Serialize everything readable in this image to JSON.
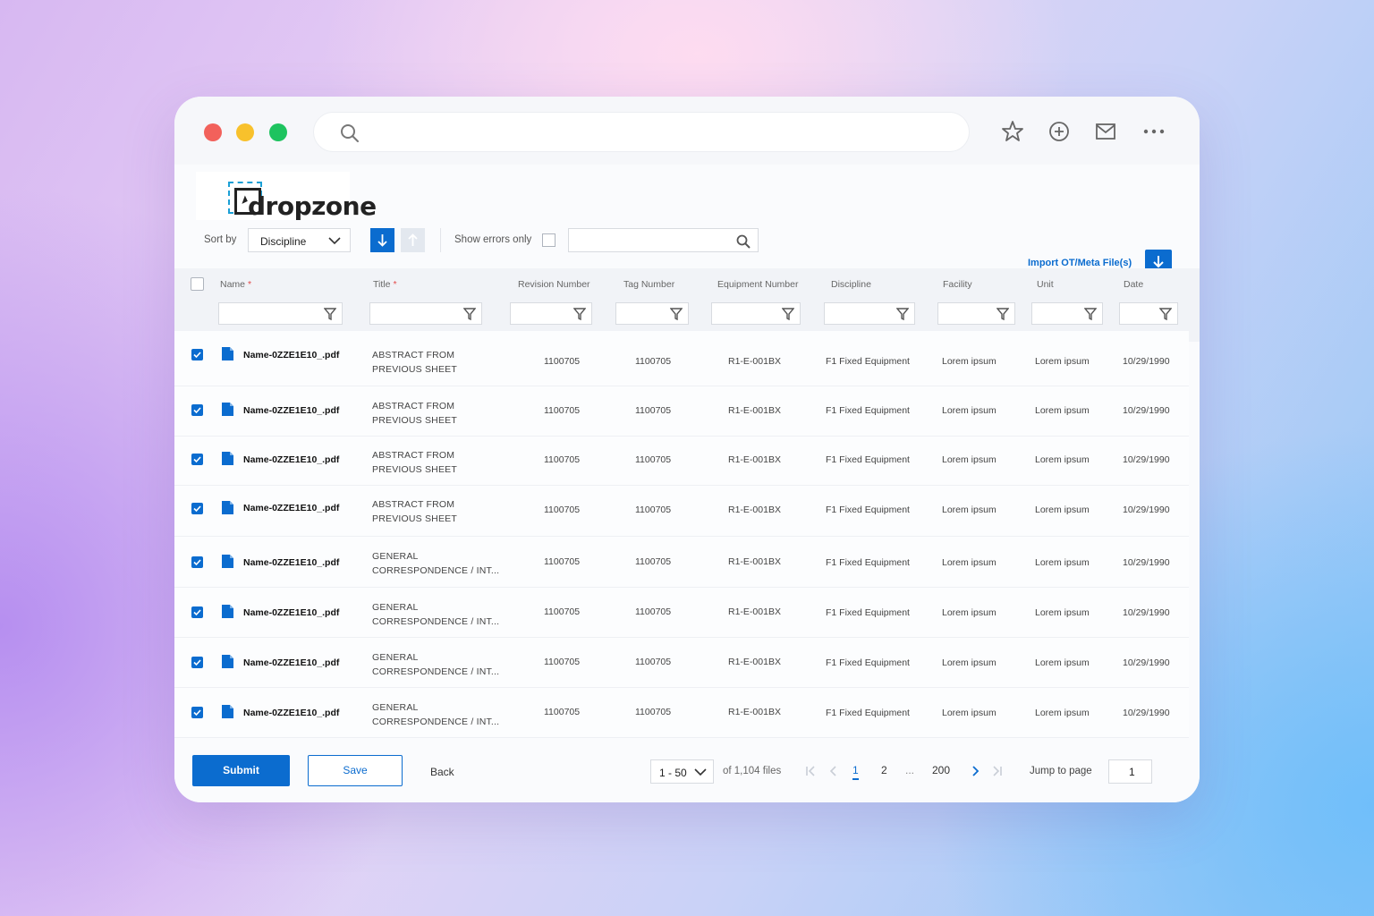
{
  "app": {
    "logo_text": "dropzone"
  },
  "header": {
    "import_label": "Import OT/Meta File(s)"
  },
  "toolbar": {
    "sort_label": "Sort by",
    "sort_value": "Discipline",
    "show_errors_label": "Show errors only",
    "search_placeholder": ""
  },
  "columns": [
    {
      "label": "Name",
      "required": "*"
    },
    {
      "label": "Title",
      "required": "*"
    },
    {
      "label": "Revision Number"
    },
    {
      "label": "Tag Number"
    },
    {
      "label": "Equipment Number"
    },
    {
      "label": "Discipline"
    },
    {
      "label": "Facility"
    },
    {
      "label": "Unit"
    },
    {
      "label": "Date"
    }
  ],
  "rows": [
    {
      "name": "Name-0ZZE1E10_.pdf",
      "title1": "ABSTRACT FROM",
      "title2": "PREVIOUS SHEET",
      "revision": "1100705",
      "tag": "1100705",
      "equipment": "R1-E-001BX",
      "discipline": "F1 Fixed Equipment",
      "facility": "Lorem ipsum",
      "unit": "Lorem ipsum",
      "date": "10/29/1990"
    },
    {
      "name": "Name-0ZZE1E10_.pdf",
      "title1": "ABSTRACT FROM",
      "title2": "PREVIOUS SHEET",
      "revision": "1100705",
      "tag": "1100705",
      "equipment": "R1-E-001BX",
      "discipline": "F1 Fixed Equipment",
      "facility": "Lorem ipsum",
      "unit": "Lorem ipsum",
      "date": "10/29/1990"
    },
    {
      "name": "Name-0ZZE1E10_.pdf",
      "title1": "ABSTRACT FROM",
      "title2": "PREVIOUS SHEET",
      "revision": "1100705",
      "tag": "1100705",
      "equipment": "R1-E-001BX",
      "discipline": "F1 Fixed Equipment",
      "facility": "Lorem ipsum",
      "unit": "Lorem ipsum",
      "date": "10/29/1990"
    },
    {
      "name": "Name-0ZZE1E10_.pdf",
      "title1": "ABSTRACT FROM",
      "title2": "PREVIOUS SHEET",
      "revision": "1100705",
      "tag": "1100705",
      "equipment": "R1-E-001BX",
      "discipline": "F1 Fixed Equipment",
      "facility": "Lorem ipsum",
      "unit": "Lorem ipsum",
      "date": "10/29/1990"
    },
    {
      "name": "Name-0ZZE1E10_.pdf",
      "title1": "GENERAL",
      "title2": "CORRESPONDENCE / INT...",
      "revision": "1100705",
      "tag": "1100705",
      "equipment": "R1-E-001BX",
      "discipline": "F1 Fixed Equipment",
      "facility": "Lorem ipsum",
      "unit": "Lorem ipsum",
      "date": "10/29/1990"
    },
    {
      "name": "Name-0ZZE1E10_.pdf",
      "title1": "GENERAL",
      "title2": "CORRESPONDENCE / INT...",
      "revision": "1100705",
      "tag": "1100705",
      "equipment": "R1-E-001BX",
      "discipline": "F1 Fixed Equipment",
      "facility": "Lorem ipsum",
      "unit": "Lorem ipsum",
      "date": "10/29/1990"
    },
    {
      "name": "Name-0ZZE1E10_.pdf",
      "title1": "GENERAL",
      "title2": "CORRESPONDENCE / INT...",
      "revision": "1100705",
      "tag": "1100705",
      "equipment": "R1-E-001BX",
      "discipline": "F1 Fixed Equipment",
      "facility": "Lorem ipsum",
      "unit": "Lorem ipsum",
      "date": "10/29/1990"
    },
    {
      "name": "Name-0ZZE1E10_.pdf",
      "title1": "GENERAL",
      "title2": "CORRESPONDENCE / INT...",
      "revision": "1100705",
      "tag": "1100705",
      "equipment": "R1-E-001BX",
      "discipline": "F1 Fixed Equipment",
      "facility": "Lorem ipsum",
      "unit": "Lorem ipsum",
      "date": "10/29/1990"
    }
  ],
  "footer": {
    "submit_label": "Submit",
    "save_label": "Save",
    "back_label": "Back",
    "per_page": "1 - 50",
    "of_files": "of 1,104 files",
    "page_1": "1",
    "page_2": "2",
    "ellipsis": "...",
    "page_last": "200",
    "jump_label": "Jump to page",
    "jump_value": "1"
  },
  "colors": {
    "accent": "#0b6ccf",
    "required": "#e34b4b"
  },
  "icons": [
    "search-icon",
    "star-icon",
    "plus-circle-icon",
    "mail-icon",
    "more-icon",
    "download-icon",
    "chevron-down-icon",
    "arrow-down-icon",
    "arrow-up-icon",
    "filter-icon",
    "file-icon",
    "check-icon",
    "first-page-icon",
    "prev-page-icon",
    "next-page-icon",
    "last-page-icon"
  ]
}
